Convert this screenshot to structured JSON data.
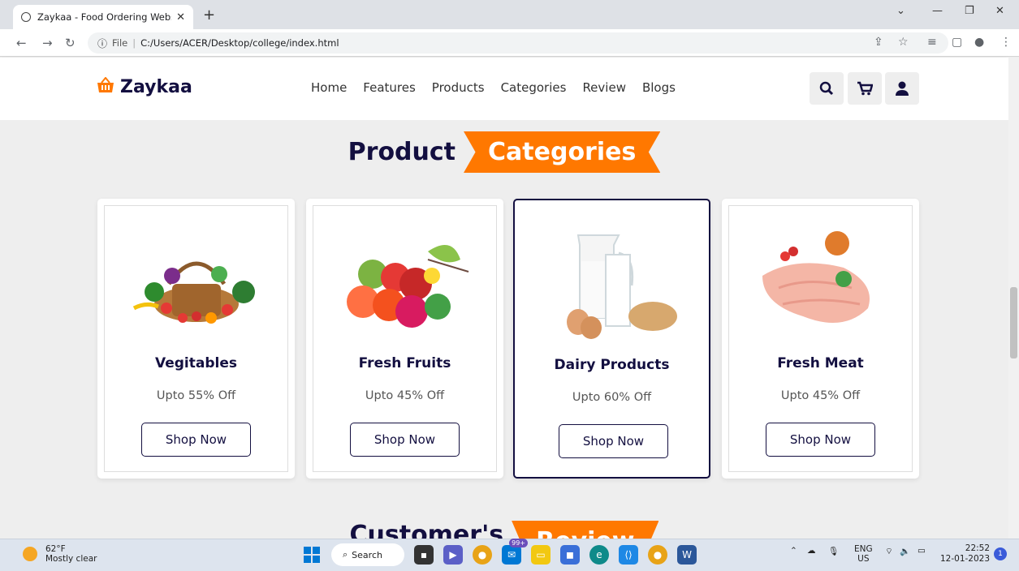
{
  "browser": {
    "tab_title": "Zaykaa - Food Ordering Website",
    "tab_close": "✕",
    "new_tab": "+",
    "file_label": "File",
    "url": "C:/Users/ACER/Desktop/college/index.html"
  },
  "site": {
    "logo_text": "Zaykaa",
    "nav": [
      "Home",
      "Features",
      "Products",
      "Categories",
      "Review",
      "Blogs"
    ]
  },
  "section": {
    "title_part1": "Product",
    "title_part2": "Categories",
    "next_title_part1": "Customer's",
    "next_title_part2": "Review"
  },
  "categories": [
    {
      "name": "Vegitables",
      "offer": "Upto 55% Off",
      "button": "Shop Now",
      "icon": "vegetable-basket-image"
    },
    {
      "name": "Fresh Fruits",
      "offer": "Upto 45% Off",
      "button": "Shop Now",
      "icon": "fruits-image"
    },
    {
      "name": "Dairy Products",
      "offer": "Upto 60% Off",
      "button": "Shop Now",
      "icon": "dairy-image"
    },
    {
      "name": "Fresh Meat",
      "offer": "Upto 45% Off",
      "button": "Shop Now",
      "icon": "meat-image"
    }
  ],
  "taskbar": {
    "temp": "62°F",
    "weather": "Mostly clear",
    "search": "Search",
    "badge": "99+",
    "lang": "ENG",
    "region": "US",
    "time": "22:52",
    "date": "12-01-2023",
    "notif_count": "1"
  },
  "colors": {
    "accent": "#ff7800",
    "dark": "#130f40"
  }
}
